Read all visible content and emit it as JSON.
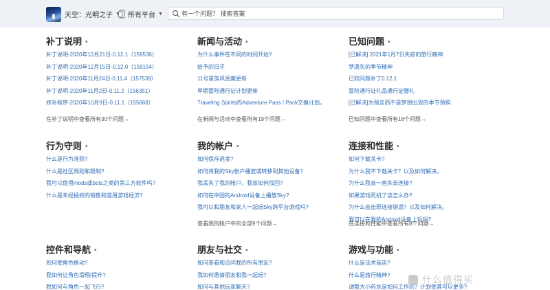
{
  "header": {
    "app_label": "天空：光明之子",
    "platform_label": "所有平台",
    "search_placeholder": "有一个问题？ 搜索答案"
  },
  "sections": [
    {
      "title": "补丁说明",
      "links": [
        "补丁说明-2020年12月21日-0.12.1（159536）",
        "补丁说明-2020年12月15日-0.12.0（159154）",
        "补丁说明-2020年11月24日-0.11.4（157539）",
        "补丁说明-2020年11月2日-0.11.2（156351）",
        "修补程序-2020年10月9日-0.11.1（155668）"
      ],
      "more": "在补丁说明中查看所有30个问题→"
    },
    {
      "title": "新闻与活动",
      "links": [
        "为什么事件在不同的时间开始?",
        "给予的日子",
        "11号星族风图案更新",
        "早期雷险通行证计划更新",
        "Traveling Spirits的Adventure Pass / Pack交换计划。"
      ],
      "more": "在新闻与活动中查看所有19个问题→"
    },
    {
      "title": "已知问题",
      "links": [
        "[已解决] 2021年1月7日失踪的旅行精神",
        "梦遗失的季节精神",
        "已知问题补丁0.12.1",
        "冒险通行证礼品通行证赠礼",
        "[已解决]为预言而不是梦想出现的季节预购"
      ],
      "more": "已知问题中查看所有18个问题→"
    },
    {
      "title": "行为守则",
      "links": [
        "什么是行为准则?",
        "什么是社区规则和限制?",
        "我可以使用mods或bots之类的第三方软件吗?",
        "什么是未经授权的销售和滥用游戏经济?"
      ],
      "more": ""
    },
    {
      "title": "我的帐户",
      "links": [
        "如何保存进度?",
        "如何将我的Sky帐户播放或转移到其他设备?",
        "我丢失了我的帐户。我该如何找回?",
        "如何在中国的Android设备上播放Sky?",
        "我可以和朋友和家人一起玩Sky跨平台游戏吗?"
      ],
      "more": "查看我的帐户中的全部9个问题→"
    },
    {
      "title": "连接和性能",
      "links": [
        "如何下载关卡?",
        "为什么我不下载关卡？以及如何解决。",
        "为什么我会一直失去连接?",
        "如果游戏死机了该怎么办?",
        "为什么会出现连接错误？以及如何解决。",
        "我可以在我的Android设备上玩吗?"
      ],
      "more": "在连接和性能中查看所有8个问题→"
    },
    {
      "title": "控件和导航",
      "links": [
        "如何使角色移动?",
        "我如何让角色滑翔/提升?",
        "我如何与角色一起飞行?"
      ],
      "more": ""
    },
    {
      "title": "朋友与社交",
      "links": [
        "如何查看和访问我的所有朋友?",
        "我如何邀请朋友和我一起玩?",
        "如何与其他玩家聊天?"
      ],
      "more": ""
    },
    {
      "title": "游戏与功能",
      "links": [
        "什么是法术商店?",
        "什么是旅行精神?",
        "调整大小药水是如何工作的？计划使其可以更多?"
      ],
      "more": ""
    }
  ],
  "watermark": "什么值得买",
  "colors": {
    "link": "#2f6db5",
    "header_bg": "#eef1f6"
  }
}
